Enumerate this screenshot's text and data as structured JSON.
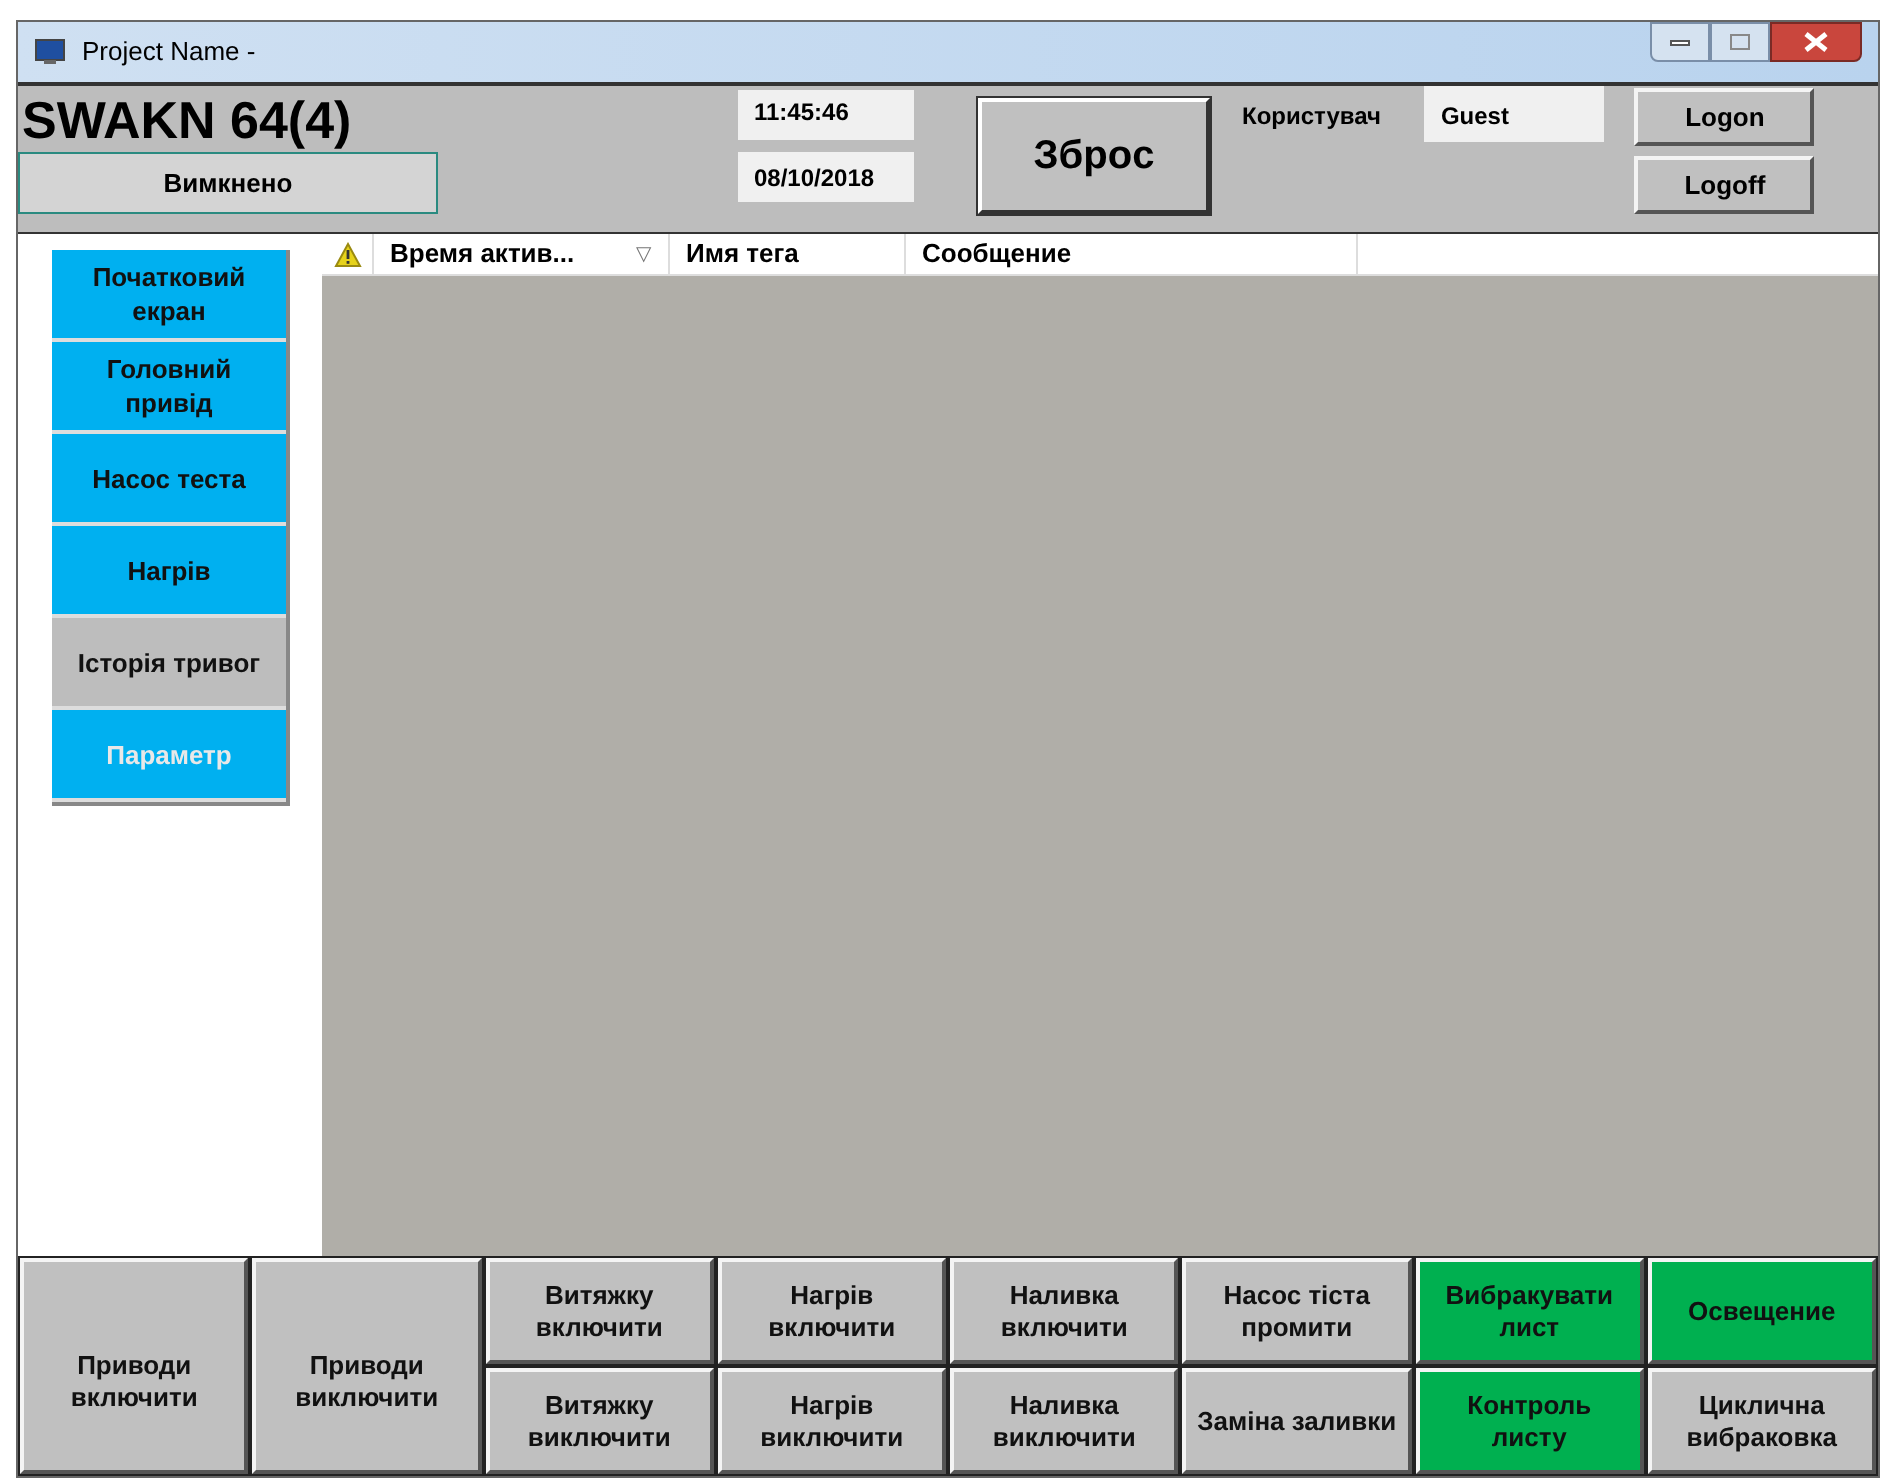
{
  "window": {
    "title": "Project Name -"
  },
  "header": {
    "title": "SWAKN 64(4)",
    "status": "Вимкнено",
    "time": "11:45:46",
    "date": "08/10/2018",
    "reset_button": "Збрoс",
    "user_label": "Користувач",
    "user": "Guest",
    "logon": "Logon",
    "logoff": "Logoff"
  },
  "nav": [
    {
      "label": "Початковий екран",
      "selected": false,
      "disabled": false
    },
    {
      "label": "Головний привід",
      "selected": false,
      "disabled": false
    },
    {
      "label": "Насос теста",
      "selected": false,
      "disabled": false
    },
    {
      "label": "Нагрів",
      "selected": false,
      "disabled": false
    },
    {
      "label": "Історія тривог",
      "selected": true,
      "disabled": false
    },
    {
      "label": "Параметр",
      "selected": false,
      "disabled": true
    }
  ],
  "alarm_table": {
    "columns": [
      {
        "label": "Время актив...",
        "sorted": true
      },
      {
        "label": "Имя тега",
        "sorted": false
      },
      {
        "label": "Сообщение",
        "sorted": false
      }
    ],
    "sort_mark": "▽"
  },
  "bottom_columns": [
    {
      "buttons": [
        {
          "label": "Приводи включити",
          "on": false
        }
      ]
    },
    {
      "buttons": [
        {
          "label": "Приводи виключити",
          "on": false
        }
      ]
    },
    {
      "buttons": [
        {
          "label": "Витяжку включити",
          "on": false
        },
        {
          "label": "Витяжку виключити",
          "on": false
        }
      ]
    },
    {
      "buttons": [
        {
          "label": "Нагрів включити",
          "on": false
        },
        {
          "label": "Нагрів виключити",
          "on": false
        }
      ]
    },
    {
      "buttons": [
        {
          "label": "Наливка включити",
          "on": false
        },
        {
          "label": "Наливка виключити",
          "on": false
        }
      ]
    },
    {
      "buttons": [
        {
          "label": "Насос тіста промити",
          "on": false
        },
        {
          "label": "Заміна заливки",
          "on": false
        }
      ]
    },
    {
      "buttons": [
        {
          "label": "Вибракувати лист",
          "on": true
        },
        {
          "label": "Контроль листу",
          "on": true
        }
      ]
    },
    {
      "buttons": [
        {
          "label": "Освещение",
          "on": true
        },
        {
          "label": "Циклична вибраковка",
          "on": false
        }
      ]
    }
  ]
}
